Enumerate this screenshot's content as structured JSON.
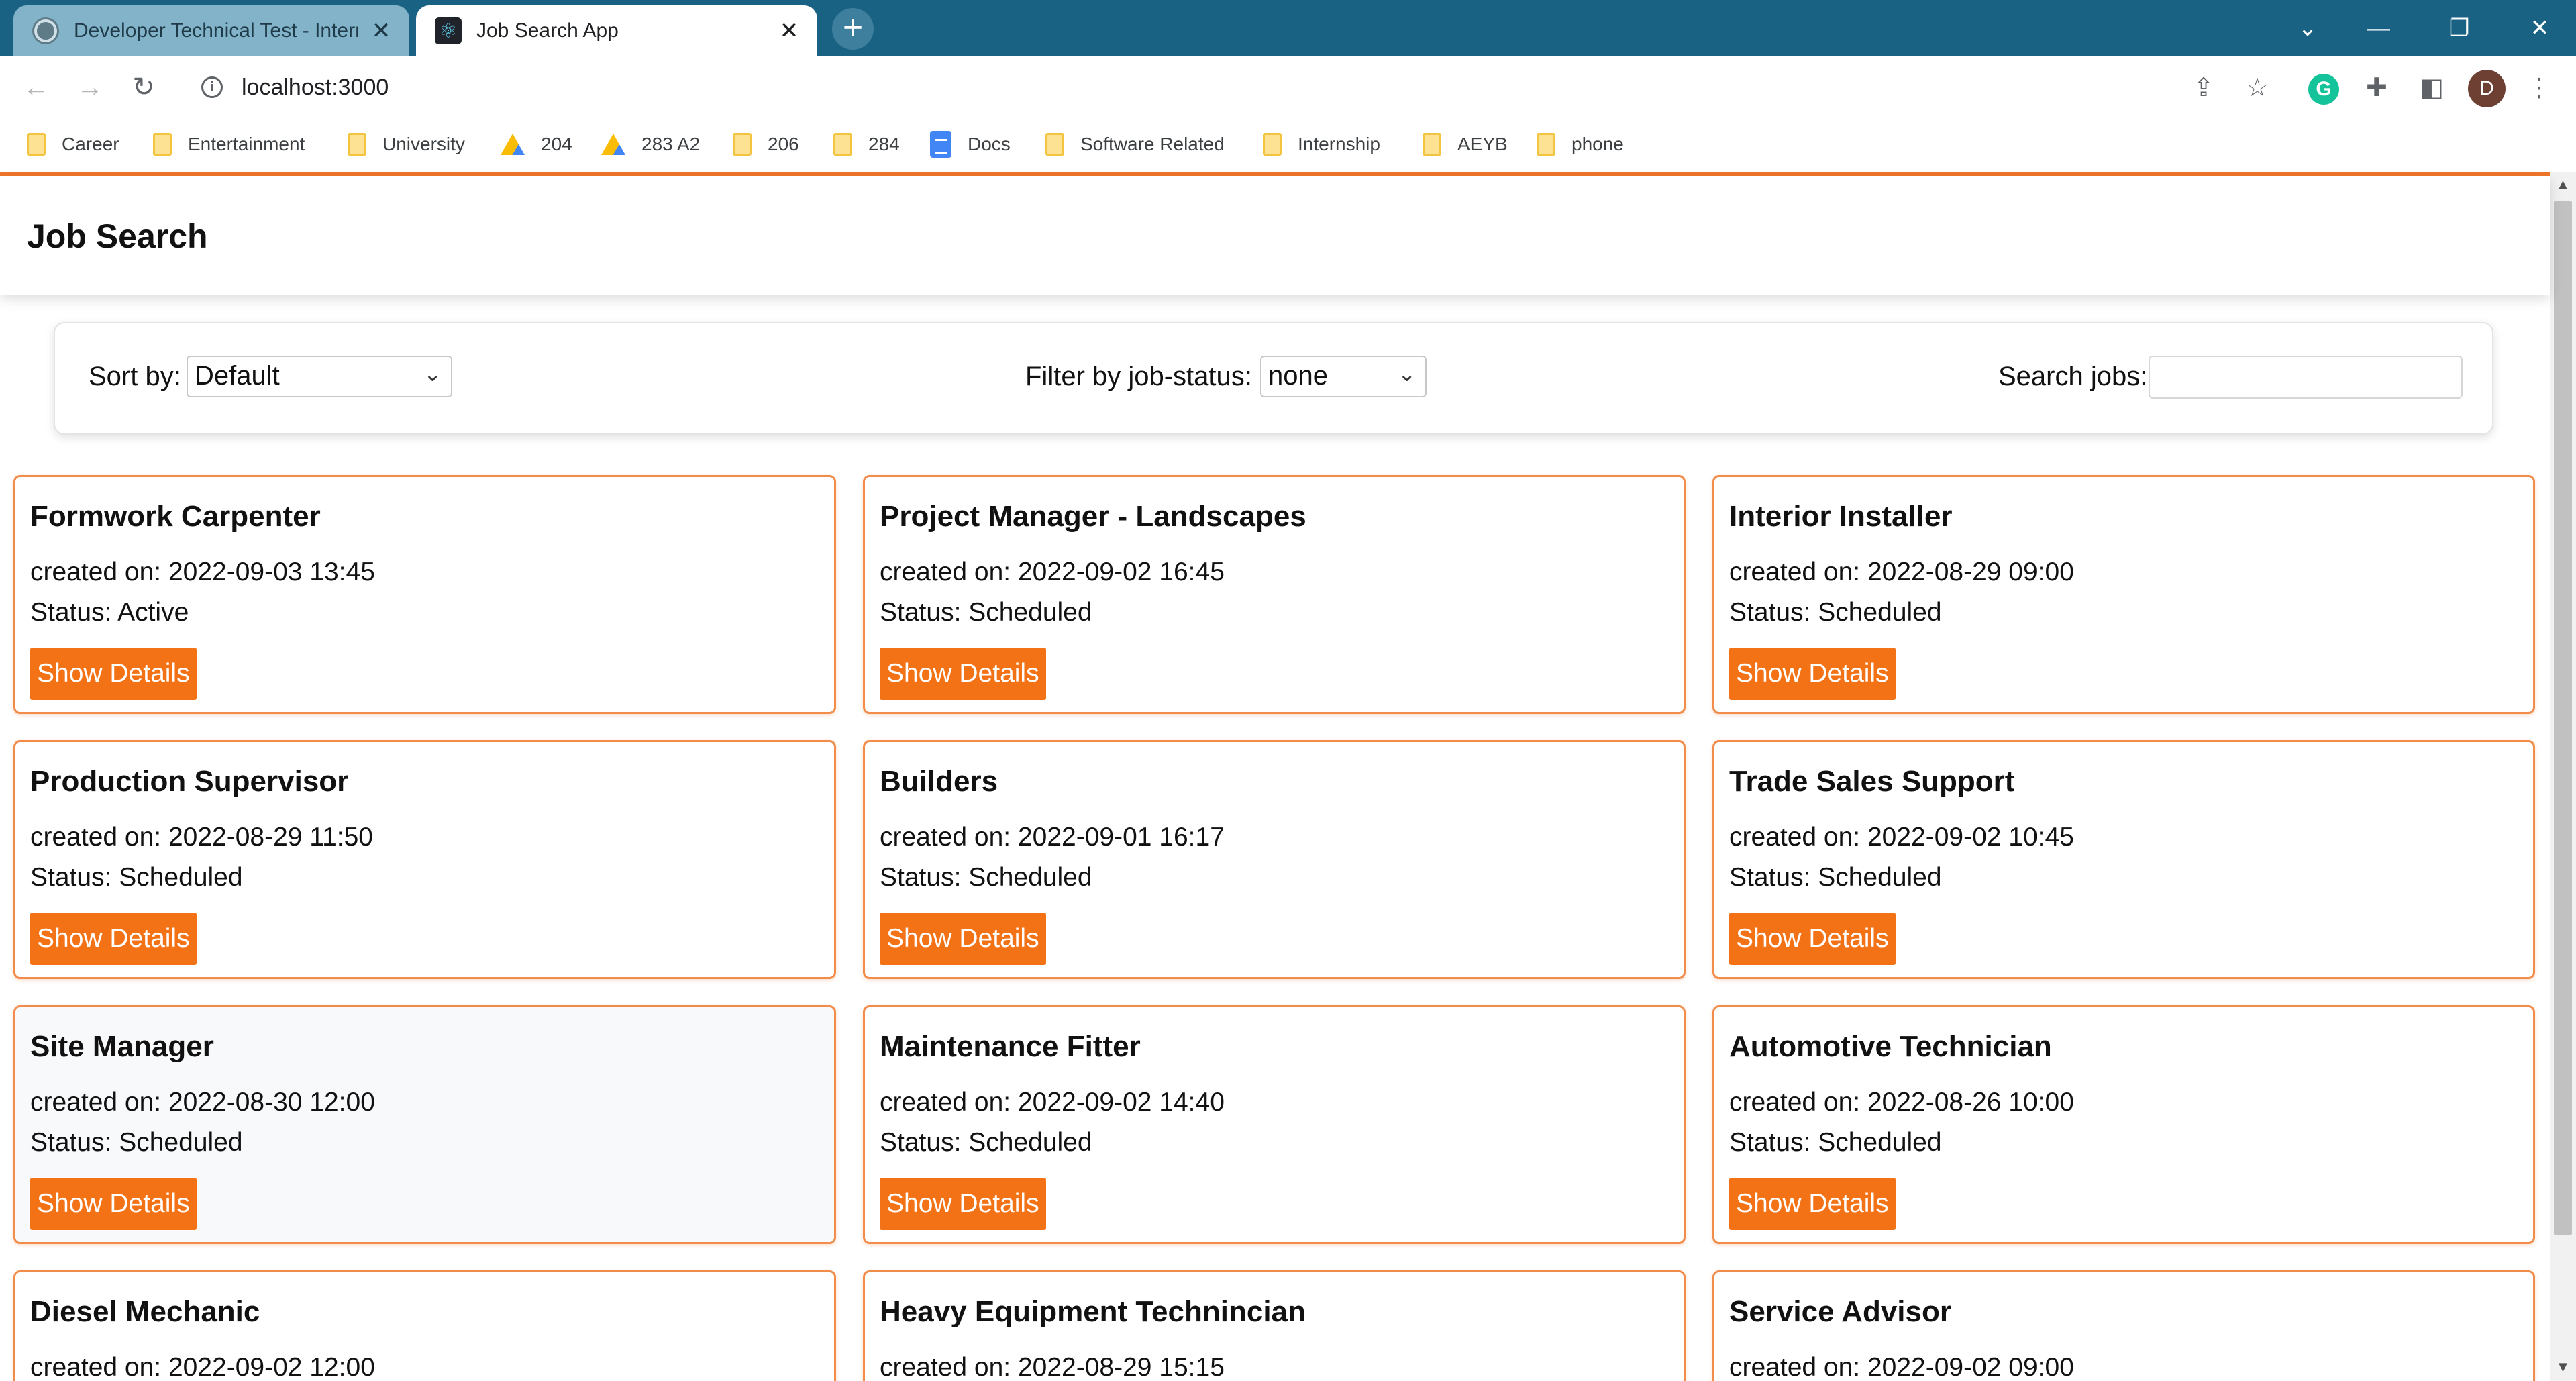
{
  "browser": {
    "tabs": [
      {
        "title": "Developer Technical Test - Intern",
        "close": "✕"
      },
      {
        "title": "Job Search App",
        "close": "✕"
      }
    ],
    "new_tab_icon": "plus-icon",
    "window_controls": {
      "dropdown": "⌄",
      "minimize": "—",
      "restore": "❐",
      "close": "✕"
    },
    "url": "localhost:3000",
    "profile_initial": "D",
    "grammarly_initial": "G",
    "bookmarks": [
      {
        "label": "Career",
        "icon": "folder"
      },
      {
        "label": "Entertainment",
        "icon": "folder"
      },
      {
        "label": "University",
        "icon": "folder"
      },
      {
        "label": "204",
        "icon": "drive"
      },
      {
        "label": "283 A2",
        "icon": "drive"
      },
      {
        "label": "206",
        "icon": "folder"
      },
      {
        "label": "284",
        "icon": "folder"
      },
      {
        "label": "Docs",
        "icon": "docs"
      },
      {
        "label": "Software Related",
        "icon": "folder"
      },
      {
        "label": "Internship",
        "icon": "folder"
      },
      {
        "label": "AEYB",
        "icon": "folder"
      },
      {
        "label": "phone",
        "icon": "folder"
      }
    ]
  },
  "app": {
    "title": "Job Search",
    "controls": {
      "sort_label": "Sort by:",
      "sort_value": "Default",
      "filter_label": "Filter by job-status:",
      "filter_value": "none",
      "search_label": "Search jobs:",
      "search_value": ""
    },
    "jobs": [
      {
        "title": "Formwork Carpenter",
        "created": "created on: 2022-09-03 13:45",
        "status": "Status: Active",
        "button": "Show Details"
      },
      {
        "title": "Project Manager - Landscapes",
        "created": "created on: 2022-09-02 16:45",
        "status": "Status: Scheduled",
        "button": "Show Details"
      },
      {
        "title": "Interior Installer",
        "created": "created on: 2022-08-29 09:00",
        "status": "Status: Scheduled",
        "button": "Show Details"
      },
      {
        "title": "Production Supervisor",
        "created": "created on: 2022-08-29 11:50",
        "status": "Status: Scheduled",
        "button": "Show Details"
      },
      {
        "title": "Builders",
        "created": "created on: 2022-09-01 16:17",
        "status": "Status: Scheduled",
        "button": "Show Details"
      },
      {
        "title": "Trade Sales Support",
        "created": "created on: 2022-09-02 10:45",
        "status": "Status: Scheduled",
        "button": "Show Details"
      },
      {
        "title": "Site Manager",
        "created": "created on: 2022-08-30 12:00",
        "status": "Status: Scheduled",
        "button": "Show Details"
      },
      {
        "title": "Maintenance Fitter",
        "created": "created on: 2022-09-02 14:40",
        "status": "Status: Scheduled",
        "button": "Show Details"
      },
      {
        "title": "Automotive Technician",
        "created": "created on: 2022-08-26 10:00",
        "status": "Status: Scheduled",
        "button": "Show Details"
      },
      {
        "title": "Diesel Mechanic",
        "created": "created on: 2022-09-02 12:00",
        "status": "",
        "button": ""
      },
      {
        "title": "Heavy Equipment Technincian",
        "created": "created on: 2022-08-29 15:15",
        "status": "",
        "button": ""
      },
      {
        "title": "Service Advisor",
        "created": "created on: 2022-09-02 09:00",
        "status": "",
        "button": ""
      }
    ]
  },
  "colors": {
    "accent": "#f47216",
    "card_border": "#f28c4b",
    "tabbar": "#1a6283"
  }
}
